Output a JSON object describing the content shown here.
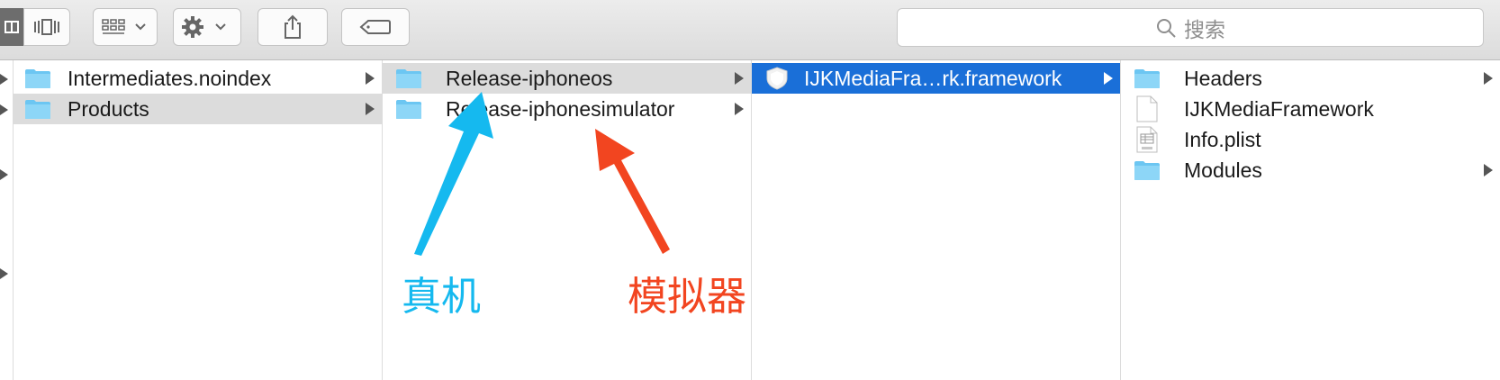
{
  "search": {
    "placeholder": "搜索"
  },
  "columns": [
    {
      "items": [
        {
          "label": "Intermediates.noindex",
          "icon": "folder-icon",
          "state": "normal"
        },
        {
          "label": "Products",
          "icon": "folder-icon",
          "state": "selected-inactive"
        }
      ]
    },
    {
      "items": [
        {
          "label": "Release-iphoneos",
          "icon": "folder-icon",
          "state": "selected-inactive"
        },
        {
          "label": "Release-iphonesimulator",
          "icon": "folder-icon",
          "state": "normal"
        }
      ]
    },
    {
      "items": [
        {
          "label": "IJKMediaFra…rk.framework",
          "icon": "framework-icon",
          "state": "selected-active"
        }
      ]
    },
    {
      "items": [
        {
          "label": "Headers",
          "icon": "folder-icon"
        },
        {
          "label": "IJKMediaFramework",
          "icon": "file-icon"
        },
        {
          "label": "Info.plist",
          "icon": "plist-icon"
        },
        {
          "label": "Modules",
          "icon": "folder-icon"
        }
      ]
    }
  ],
  "annotations": {
    "device": {
      "label": "真机",
      "color": "#15b9ef"
    },
    "simulator": {
      "label": "模拟器",
      "color": "#f24520"
    }
  },
  "colors": {
    "selection_active": "#1a6fd8",
    "selection_inactive": "#dcdcdc",
    "folder": "#6cc6f2"
  }
}
